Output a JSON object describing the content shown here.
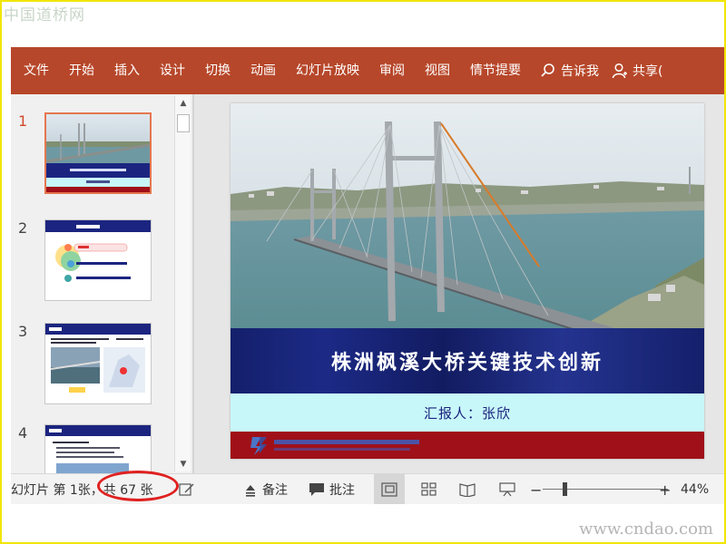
{
  "watermark_top": "中国道桥网",
  "watermark_bottom": "www.cndao.com",
  "ribbon": {
    "tabs": [
      "文件",
      "开始",
      "插入",
      "设计",
      "切换",
      "动画",
      "幻灯片放映",
      "审阅",
      "视图",
      "情节提要"
    ],
    "tell_me": "告诉我",
    "share": "共享("
  },
  "thumbnails": [
    {
      "number": "1",
      "active": true
    },
    {
      "number": "2",
      "active": false
    },
    {
      "number": "3",
      "active": false
    },
    {
      "number": "4",
      "active": false
    }
  ],
  "slide": {
    "title": "株洲枫溪大桥关键技术创新",
    "reporter": "汇报人：张欣"
  },
  "statusbar": {
    "slide_info": "幻灯片 第 1张，共 67 张",
    "notes": "备注",
    "comments": "批注",
    "zoom_minus": "−",
    "zoom_plus": "+",
    "zoom_percent": "44%"
  },
  "colors": {
    "ribbon": "#b7472a",
    "title_band": "#14206b",
    "reporter_band": "#c8f7f9",
    "footer_band": "#a01018",
    "highlight_oval": "#e02020"
  }
}
